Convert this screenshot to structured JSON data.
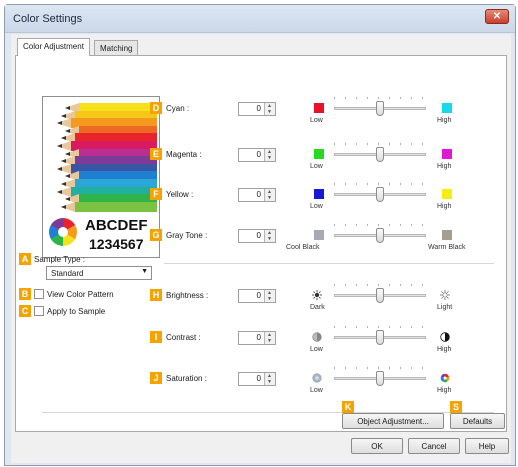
{
  "window": {
    "title": "Color Settings",
    "close_glyph": "✕"
  },
  "tabs": [
    {
      "label": "Color Adjustment"
    },
    {
      "label": "Matching"
    }
  ],
  "preview": {
    "text1": "ABCDEF",
    "text2": "1234567",
    "pencil_colors": [
      "#f7e11b",
      "#f6c619",
      "#f39a1f",
      "#ee6a22",
      "#e8232b",
      "#d81b60",
      "#b83093",
      "#7d3a97",
      "#3a55a4",
      "#1f7fd1",
      "#2aa6d9",
      "#21b0a0",
      "#2fb44a",
      "#7cc242"
    ]
  },
  "colorbal": [
    {
      "badge": "D",
      "label": "Cyan :",
      "value": "0",
      "left_color": "#e8102a",
      "right_color": "#17d9ea",
      "low": "Low",
      "high": "High"
    },
    {
      "badge": "E",
      "label": "Magenta :",
      "value": "0",
      "left_color": "#27d821",
      "right_color": "#e019d5",
      "low": "Low",
      "high": "High"
    },
    {
      "badge": "F",
      "label": "Yellow :",
      "value": "0",
      "left_color": "#1717d9",
      "right_color": "#f6ee12",
      "low": "Low",
      "high": "High"
    },
    {
      "badge": "G",
      "label": "Gray Tone :",
      "value": "0",
      "left_color": "#a7a9b5",
      "right_color": "#a49e91",
      "low": "Cool Black",
      "high": "Warm Black"
    }
  ],
  "sample": {
    "badge_a": "A",
    "type_label": "Sample Type :",
    "type_value": "Standard",
    "badge_b": "B",
    "view_label": "View Color Pattern",
    "badge_c": "C",
    "apply_label": "Apply to Sample"
  },
  "adjust": [
    {
      "badge": "H",
      "label": "Brightness :",
      "value": "0",
      "low": "Dark",
      "high": "Light",
      "left_icon": "sun-dark-icon",
      "right_icon": "sun-light-icon"
    },
    {
      "badge": "I",
      "label": "Contrast :",
      "value": "0",
      "low": "Low",
      "high": "High",
      "left_icon": "contrast-low-icon",
      "right_icon": "contrast-high-icon"
    },
    {
      "badge": "J",
      "label": "Saturation :",
      "value": "0",
      "low": "Low",
      "high": "High",
      "left_icon": "saturation-low-icon",
      "right_icon": "saturation-high-icon"
    }
  ],
  "buttons": {
    "badge_k": "K",
    "object_adjustment": "Object Adjustment...",
    "badge_s": "S",
    "defaults": "Defaults",
    "ok": "OK",
    "cancel": "Cancel",
    "help": "Help"
  }
}
